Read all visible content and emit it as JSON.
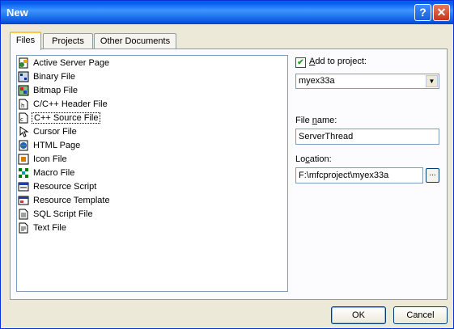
{
  "window": {
    "title": "New",
    "help_glyph": "?",
    "close_glyph": "✕"
  },
  "tabs": [
    {
      "label": "Files"
    },
    {
      "label": "Projects"
    },
    {
      "label": "Other Documents"
    }
  ],
  "file_types": [
    {
      "label": "Active Server Page",
      "icon": "asp-file-icon"
    },
    {
      "label": "Binary File",
      "icon": "binary-file-icon"
    },
    {
      "label": "Bitmap File",
      "icon": "bitmap-file-icon"
    },
    {
      "label": "C/C++ Header File",
      "icon": "header-file-icon"
    },
    {
      "label": "C++ Source File",
      "icon": "cpp-file-icon",
      "selected": true
    },
    {
      "label": "Cursor File",
      "icon": "cursor-file-icon"
    },
    {
      "label": "HTML Page",
      "icon": "html-file-icon"
    },
    {
      "label": "Icon File",
      "icon": "icon-file-icon"
    },
    {
      "label": "Macro File",
      "icon": "macro-file-icon"
    },
    {
      "label": "Resource Script",
      "icon": "resource-script-icon"
    },
    {
      "label": "Resource Template",
      "icon": "resource-template-icon"
    },
    {
      "label": "SQL Script File",
      "icon": "sql-file-icon"
    },
    {
      "label": "Text File",
      "icon": "text-file-icon"
    }
  ],
  "add_to_project": {
    "label_prefix": "",
    "label_access": "A",
    "label_rest": "dd to project:",
    "checked": true,
    "check_glyph": "✔",
    "project": "myex33a",
    "arrow_glyph": "▼"
  },
  "file_name": {
    "label_prefix": "File ",
    "label_access": "n",
    "label_rest": "ame:",
    "value": "ServerThread"
  },
  "location": {
    "label_prefix": "Lo",
    "label_access": "c",
    "label_rest": "ation:",
    "value": "F:\\mfcproject\\myex33a",
    "browse_label": "..."
  },
  "buttons": {
    "ok": "OK",
    "cancel": "Cancel"
  }
}
